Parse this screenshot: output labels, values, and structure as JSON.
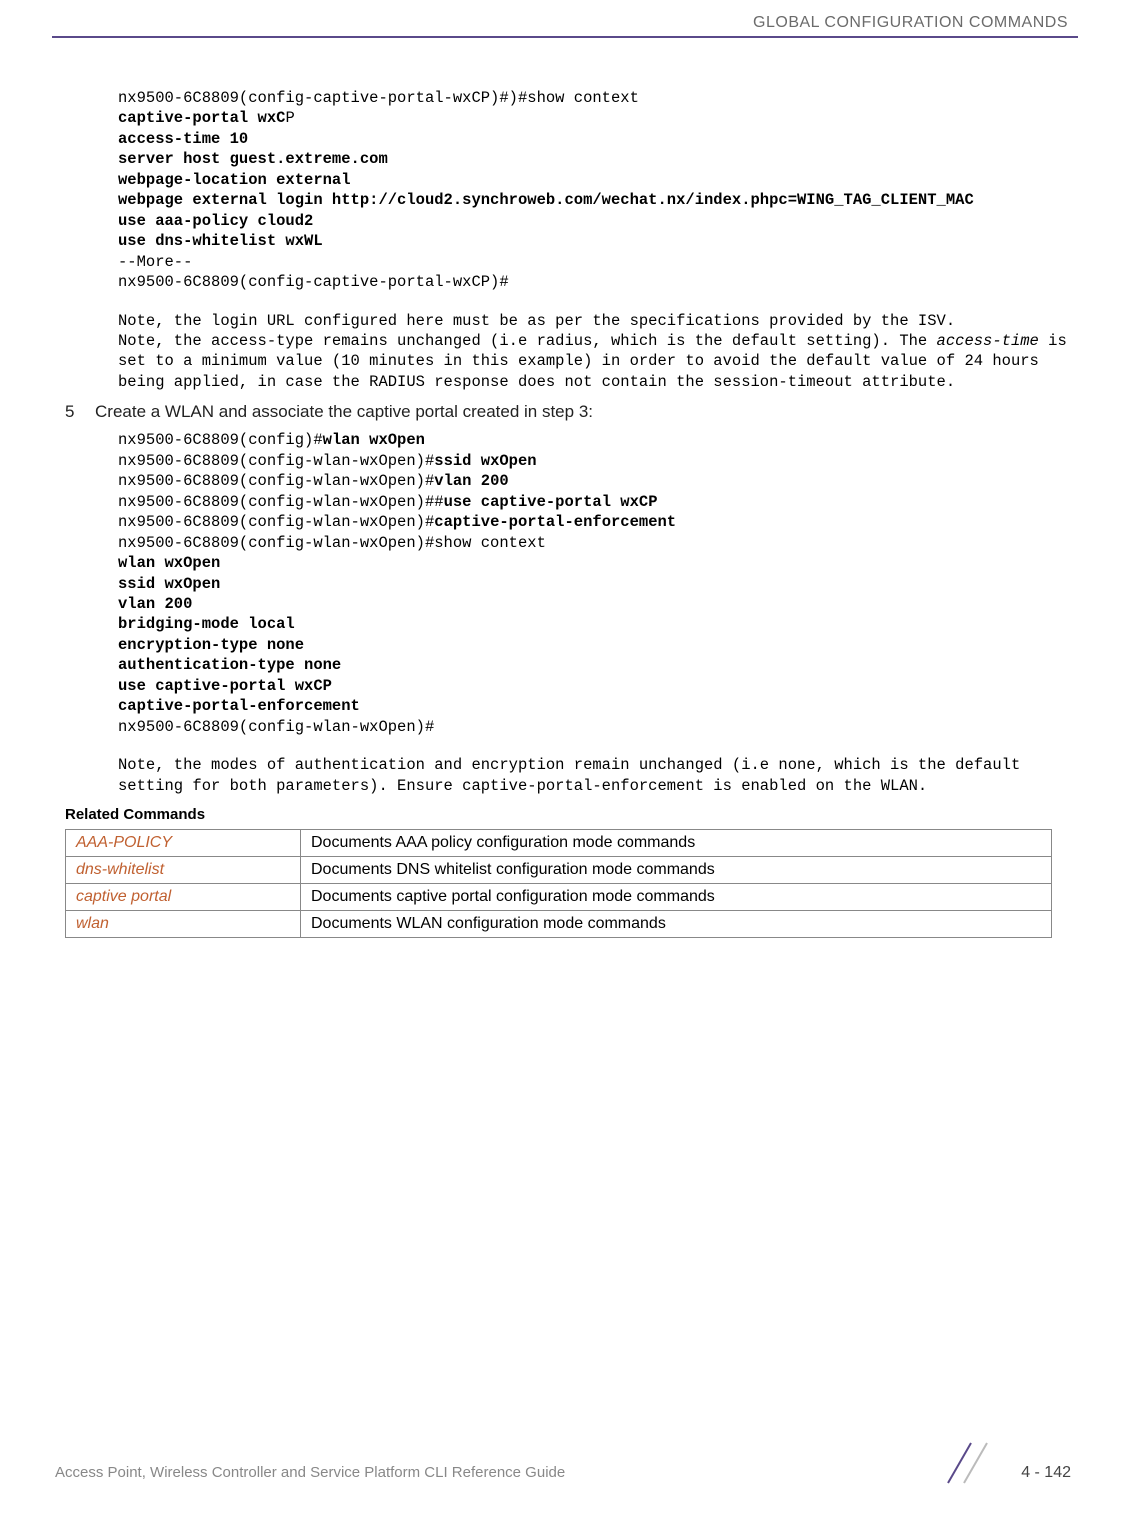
{
  "header": {
    "title": "GLOBAL CONFIGURATION COMMANDS"
  },
  "block1": {
    "line1": "nx9500-6C8809(config-captive-portal-wxCP)#)#show context",
    "line2a": "captive-portal wxC",
    "line2b": "P",
    "line3": "access-time 10",
    "line4": "server host guest.extreme.com",
    "line5": "webpage-location external",
    "line6": "webpage external login http://cloud2.synchroweb.com/wechat.nx/index.phpc=WING_TAG_CLIENT_MAC",
    "line7": "use aaa-policy cloud2",
    "line8": "use dns-whitelist wxWL",
    "line9": "--More--",
    "line10": "nx9500-6C8809(config-captive-portal-wxCP)#"
  },
  "note1": {
    "p1": "Note, the login URL configured here must be as per the specifications provided by the ISV.",
    "p2a": "Note, the access-type remains unchanged (i.e radius, which is the default setting). The ",
    "p2b": "access-time",
    "p2c": " is set to a minimum value (10 minutes in this example) in order to avoid the default value of 24 hours being applied, in case the RADIUS response does not contain the session-timeout attribute."
  },
  "step": {
    "num": "5",
    "text": "Create a WLAN and associate the captive portal created in step 3:"
  },
  "block2": {
    "l1a": "nx9500-6C8809(config)#",
    "l1b": "wlan wxOpen",
    "l2a": "nx9500-6C8809(config-wlan-wxOpen)#",
    "l2b": "ssid wxOpen",
    "l3a": "nx9500-6C8809(config-wlan-wxOpen)#",
    "l3b": "vlan 200",
    "l4a": "nx9500-6C8809(config-wlan-wxOpen)##",
    "l4b": "use captive-portal wxCP",
    "l5a": "nx9500-6C8809(config-wlan-wxOpen)#",
    "l5b": "captive-portal-enforcement",
    "l6": "nx9500-6C8809(config-wlan-wxOpen)#show context",
    "l7": "wlan wxOpen",
    "l8": "ssid wxOpen",
    "l9": "vlan 200",
    "l10": "bridging-mode local",
    "l11": "encryption-type none",
    "l12": "authentication-type none",
    "l13": "use captive-portal wxCP",
    "l14": "captive-portal-enforcement",
    "l15": "nx9500-6C8809(config-wlan-wxOpen)#"
  },
  "note2": {
    "p1": "Note, the modes of authentication and encryption remain unchanged (i.e none, which is the default setting for both parameters). Ensure captive-portal-enforcement is enabled on the WLAN."
  },
  "related": {
    "heading": "Related Commands",
    "rows": [
      {
        "cmd": "AAA-POLICY",
        "desc": "Documents AAA policy configuration mode commands"
      },
      {
        "cmd": "dns-whitelist",
        "desc": "Documents DNS whitelist configuration mode commands"
      },
      {
        "cmd": "captive portal",
        "desc": "Documents captive portal configuration mode commands"
      },
      {
        "cmd": "wlan",
        "desc": "Documents WLAN configuration mode commands"
      }
    ]
  },
  "footer": {
    "text": "Access Point, Wireless Controller and Service Platform CLI Reference Guide",
    "page": "4 - 142"
  }
}
